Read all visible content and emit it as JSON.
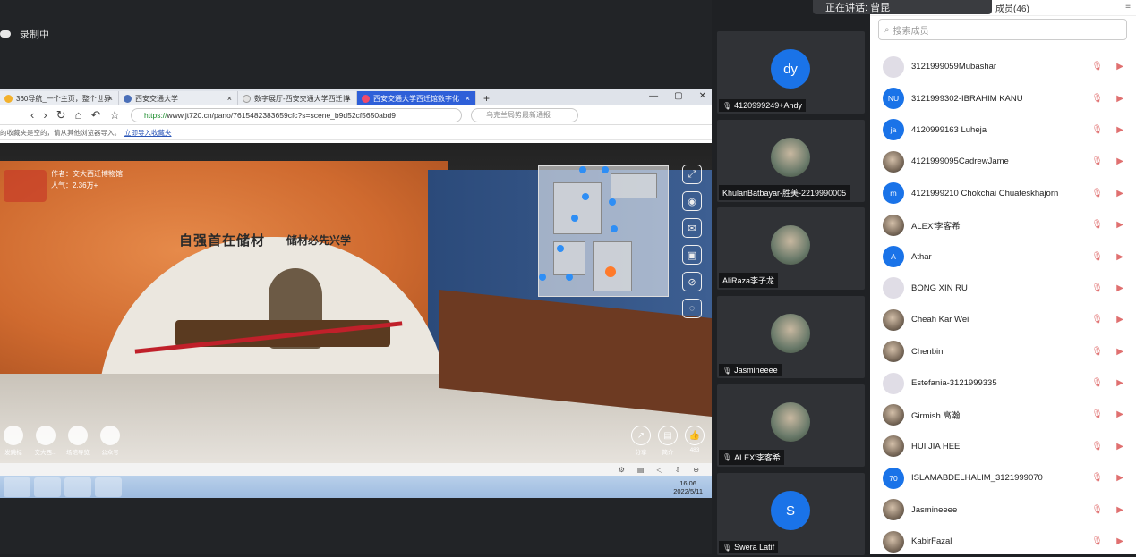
{
  "recording": {
    "label": "录制中"
  },
  "speaking": {
    "label": "正在讲话: 曾昆"
  },
  "browser": {
    "tabs": [
      {
        "label": "360导航_一个主页，整个世界"
      },
      {
        "label": "西安交通大学"
      },
      {
        "label": "数字展厅-西安交通大学西迁博"
      },
      {
        "label": "西安交通大学西迁馆数字化"
      }
    ],
    "url_https": "https://",
    "url_rest": "www.jt720.cn/pano/7615482383659cfc?s=scene_b9d52cf5650abd9",
    "search_placeholder": "乌克兰局势最新通报",
    "bookmark_text": "的收藏夹是空的，请从其他浏览器导入。",
    "bookmark_link": "立即导入收藏夹"
  },
  "pano": {
    "author": "作者：交大西迁博物馆",
    "popularity": "人气：2.36万+",
    "slogan1": "自强首在储材",
    "slogan2": "储材必先兴学",
    "bottom_icons": [
      {
        "label": "发跳标"
      },
      {
        "label": "交大西..."
      },
      {
        "label": "场馆导览"
      },
      {
        "label": "公众号"
      }
    ],
    "share_icons": [
      {
        "label": "分享",
        "glyph": "↗"
      },
      {
        "label": "简介",
        "glyph": "▤"
      },
      {
        "label": "483",
        "glyph": "👍"
      }
    ]
  },
  "taskbar": {
    "time": "16:06",
    "date": "2022/5/11"
  },
  "tiles": [
    {
      "name": "4120999249+Andy",
      "initials": "dy",
      "type": "initials",
      "top": 0
    },
    {
      "name": "KhulanBatbayar-胜美-2219990005",
      "initials": "",
      "type": "photo"
    },
    {
      "name": "AliRaza李子龙",
      "initials": "",
      "type": "photo"
    },
    {
      "name": "Jasmineeee",
      "initials": "",
      "type": "photo"
    },
    {
      "name": "ALEX'李客希",
      "initials": "",
      "type": "photo"
    },
    {
      "name": "Swera Latif",
      "initials": "S",
      "type": "initials"
    }
  ],
  "panel": {
    "title": "成员(46)",
    "search_placeholder": "搜索成员",
    "members": [
      {
        "name": "3121999059Mubashar",
        "initials": "",
        "type": "gray"
      },
      {
        "name": "3121999302-IBRAHIM KANU",
        "initials": "NU",
        "type": "initials"
      },
      {
        "name": "4120999163 Luheja",
        "initials": "ja",
        "type": "initials"
      },
      {
        "name": "4121999095CadrewJame",
        "initials": "",
        "type": "photo"
      },
      {
        "name": "4121999210 Chokchai Chuateskhajorn",
        "initials": "rn",
        "type": "initials"
      },
      {
        "name": "ALEX'李客希",
        "initials": "",
        "type": "photo"
      },
      {
        "name": "Athar",
        "initials": "A",
        "type": "initials"
      },
      {
        "name": "BONG XIN RU",
        "initials": "",
        "type": "gray"
      },
      {
        "name": "Cheah Kar Wei",
        "initials": "",
        "type": "photo"
      },
      {
        "name": "Chenbin",
        "initials": "",
        "type": "photo"
      },
      {
        "name": "Estefania-3121999335",
        "initials": "",
        "type": "gray"
      },
      {
        "name": "Girmish  高瀚",
        "initials": "",
        "type": "photo"
      },
      {
        "name": "HUI JIA HEE",
        "initials": "",
        "type": "photo"
      },
      {
        "name": "ISLAMABDELHALIM_3121999070",
        "initials": "70",
        "type": "initials"
      },
      {
        "name": "Jasmineeee",
        "initials": "",
        "type": "photo"
      },
      {
        "name": "KabirFazal",
        "initials": "",
        "type": "photo"
      }
    ]
  }
}
